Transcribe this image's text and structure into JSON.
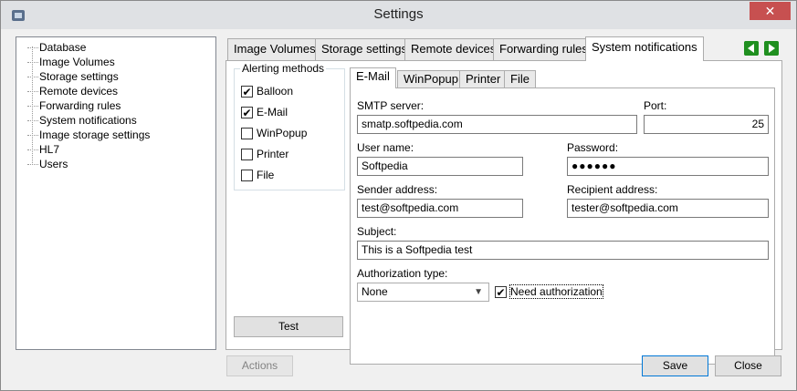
{
  "window": {
    "title": "Settings",
    "close_glyph": "✕"
  },
  "tree": {
    "items": [
      "Database",
      "Image Volumes",
      "Storage settings",
      "Remote devices",
      "Forwarding rules",
      "System notifications",
      "Image storage settings",
      "HL7",
      "Users"
    ]
  },
  "outer_tabs": [
    "Image Volumes",
    "Storage settings",
    "Remote devices",
    "Forwarding rules",
    "System notifications"
  ],
  "alerting": {
    "label": "Alerting methods",
    "methods": [
      {
        "label": "Balloon",
        "checked": true
      },
      {
        "label": "E-Mail",
        "checked": true
      },
      {
        "label": "WinPopup",
        "checked": false
      },
      {
        "label": "Printer",
        "checked": false
      },
      {
        "label": "File",
        "checked": false
      }
    ],
    "test_label": "Test"
  },
  "inner_tabs": [
    "E-Mail",
    "WinPopup",
    "Printer",
    "File"
  ],
  "email": {
    "smtp_label": "SMTP server:",
    "smtp_value": "smatp.softpedia.com",
    "port_label": "Port:",
    "port_value": "25",
    "user_label": "User name:",
    "user_value": "Softpedia",
    "password_label": "Password:",
    "password_value": "●●●●●●",
    "sender_label": "Sender address:",
    "sender_value": "test@softpedia.com",
    "recipient_label": "Recipient address:",
    "recipient_value": "tester@softpedia.com",
    "subject_label": "Subject:",
    "subject_value": "This is a Softpedia test",
    "auth_label": "Authorization type:",
    "auth_value": "None",
    "need_auth_label": "Need authorization",
    "need_auth_checked": true
  },
  "footer": {
    "actions_label": "Actions",
    "save_label": "Save",
    "close_label": "Close"
  },
  "colors": {
    "close_button": "#c75050",
    "nav_arrow": "#1f8f1f",
    "primary_border": "#0078d7"
  }
}
